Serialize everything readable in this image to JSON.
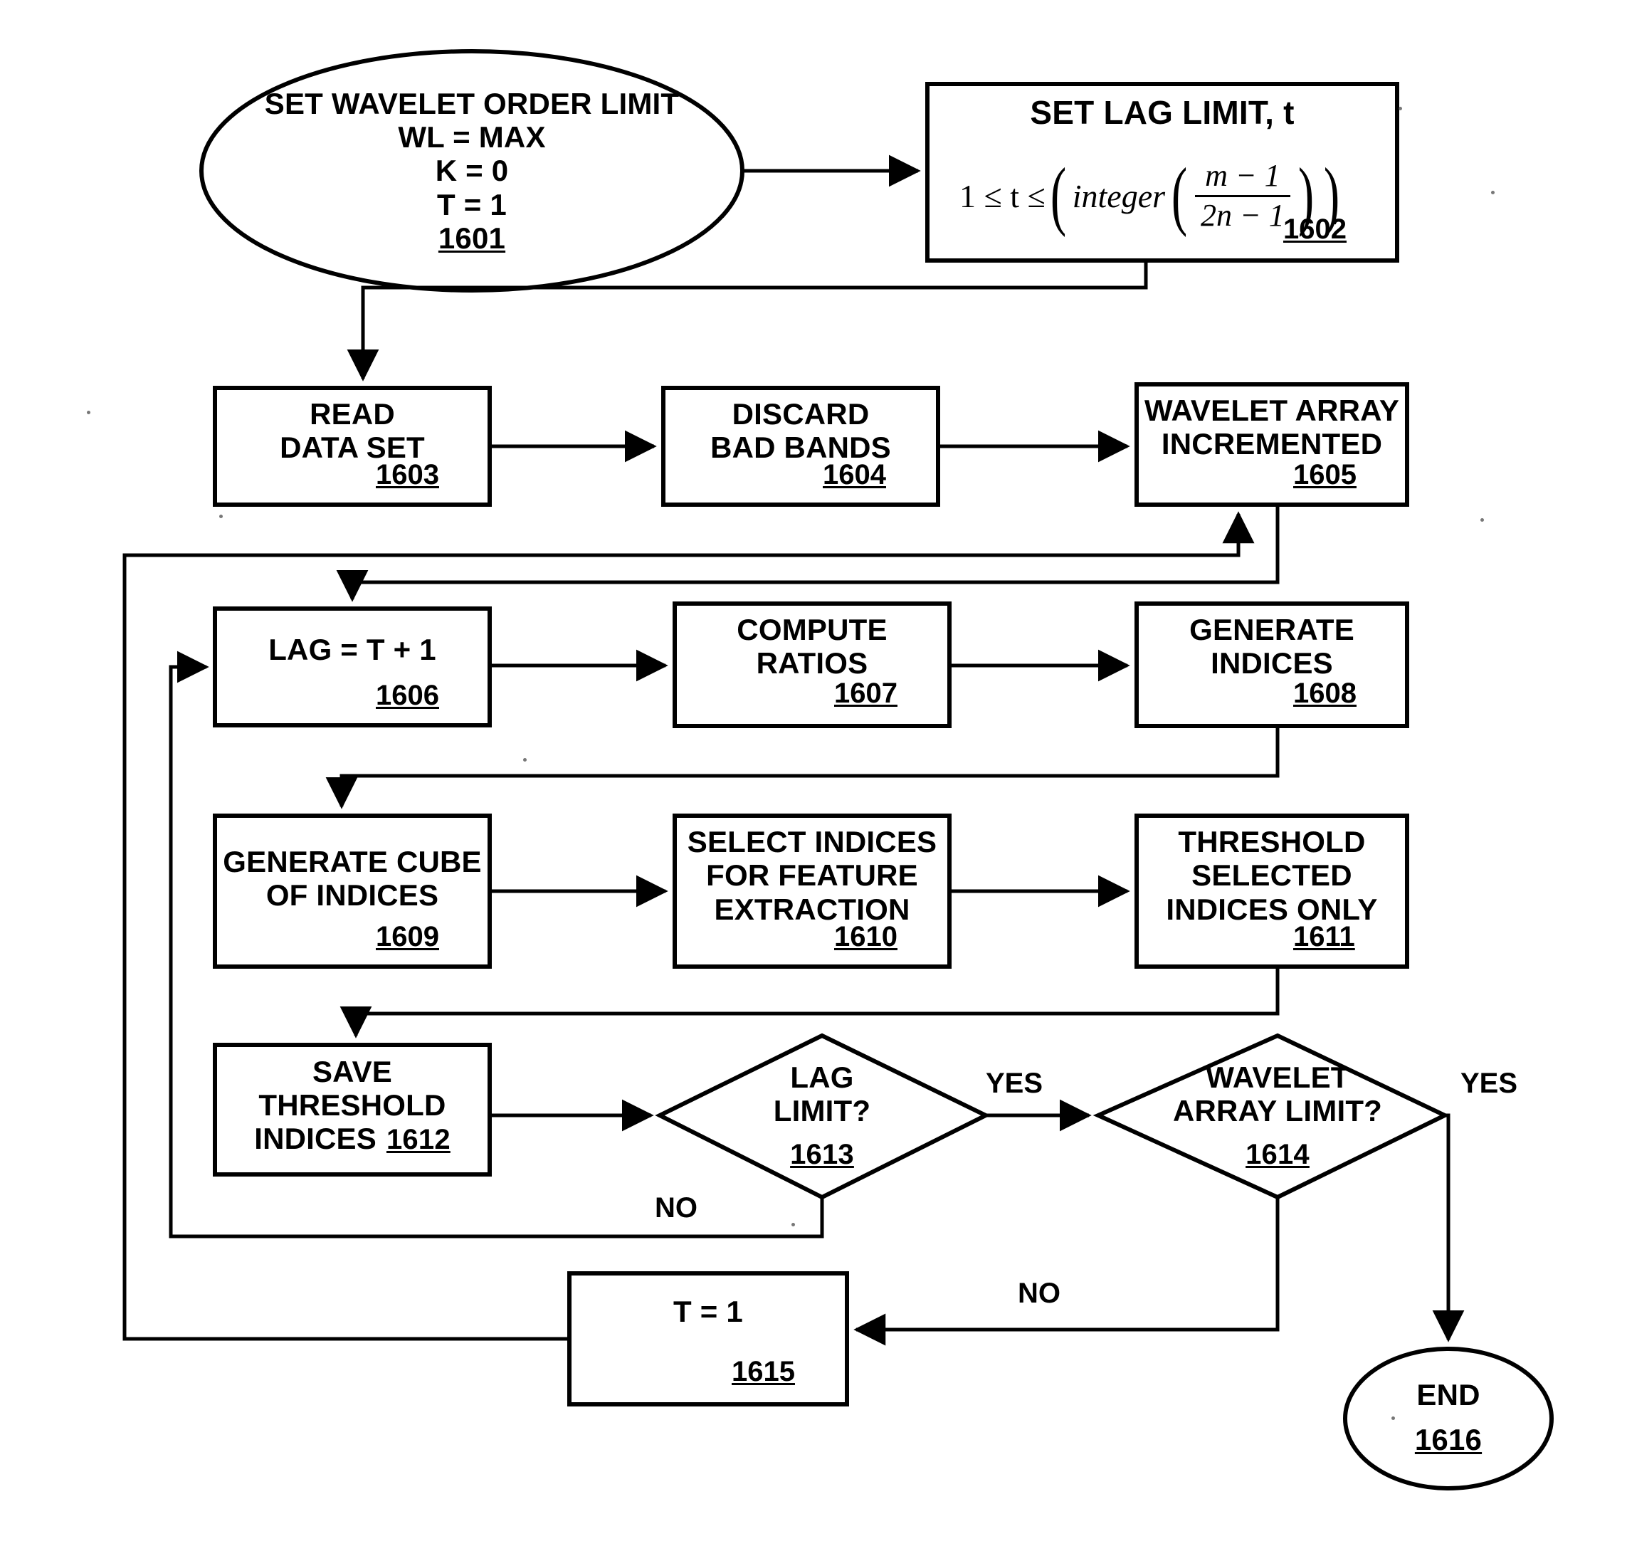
{
  "figure": {
    "type": "patent-flowchart",
    "nodes": [
      {
        "id": "1601",
        "shape": "ellipse",
        "lines": [
          "SET WAVELET ORDER LIMIT",
          "WL = MAX",
          "K = 0",
          "T = 1"
        ],
        "ref": "1601"
      },
      {
        "id": "1602",
        "shape": "rect",
        "title": "SET LAG LIMIT, t",
        "formula": "1 ≤ t ≤ ( integer ( (m − 1) / (2n − 1) ) )",
        "formula_parts": {
          "lead": "1 ≤ t ≤",
          "fn": "integer",
          "numerator": "m − 1",
          "denominator": "2n − 1"
        },
        "ref": "1602"
      },
      {
        "id": "1603",
        "shape": "rect",
        "lines": [
          "READ",
          "DATA SET"
        ],
        "ref": "1603"
      },
      {
        "id": "1604",
        "shape": "rect",
        "lines": [
          "DISCARD",
          "BAD BANDS"
        ],
        "ref": "1604"
      },
      {
        "id": "1605",
        "shape": "rect",
        "lines": [
          "WAVELET ARRAY",
          "INCREMENTED"
        ],
        "ref": "1605"
      },
      {
        "id": "1606",
        "shape": "rect",
        "lines": [
          "LAG = T + 1"
        ],
        "ref": "1606"
      },
      {
        "id": "1607",
        "shape": "rect",
        "lines": [
          "COMPUTE",
          "RATIOS"
        ],
        "ref": "1607"
      },
      {
        "id": "1608",
        "shape": "rect",
        "lines": [
          "GENERATE",
          "INDICES"
        ],
        "ref": "1608"
      },
      {
        "id": "1609",
        "shape": "rect",
        "lines": [
          "GENERATE CUBE",
          "OF INDICES"
        ],
        "ref": "1609"
      },
      {
        "id": "1610",
        "shape": "rect",
        "lines": [
          "SELECT INDICES",
          "FOR FEATURE",
          "EXTRACTION"
        ],
        "ref": "1610"
      },
      {
        "id": "1611",
        "shape": "rect",
        "lines": [
          "THRESHOLD",
          "SELECTED",
          "INDICES ONLY"
        ],
        "ref": "1611"
      },
      {
        "id": "1612",
        "shape": "rect",
        "lines": [
          "SAVE",
          "THRESHOLD",
          "INDICES"
        ],
        "ref": "1612",
        "ref_inline": true
      },
      {
        "id": "1613",
        "shape": "diamond",
        "lines": [
          "LAG",
          "LIMIT?"
        ],
        "ref": "1613"
      },
      {
        "id": "1614",
        "shape": "diamond",
        "lines": [
          "WAVELET",
          "ARRAY LIMIT?"
        ],
        "ref": "1614"
      },
      {
        "id": "1615",
        "shape": "rect",
        "lines": [
          "T = 1"
        ],
        "ref": "1615"
      },
      {
        "id": "1616",
        "shape": "ellipse",
        "lines": [
          "END"
        ],
        "ref": "1616"
      }
    ],
    "edge_labels": [
      {
        "id": "yes-1613",
        "text": "YES"
      },
      {
        "id": "yes-1614",
        "text": "YES"
      },
      {
        "id": "no-1613",
        "text": "NO"
      },
      {
        "id": "no-1614",
        "text": "NO"
      }
    ],
    "colors": {
      "stroke": "#000000",
      "background": "#ffffff",
      "text": "#000000"
    }
  }
}
